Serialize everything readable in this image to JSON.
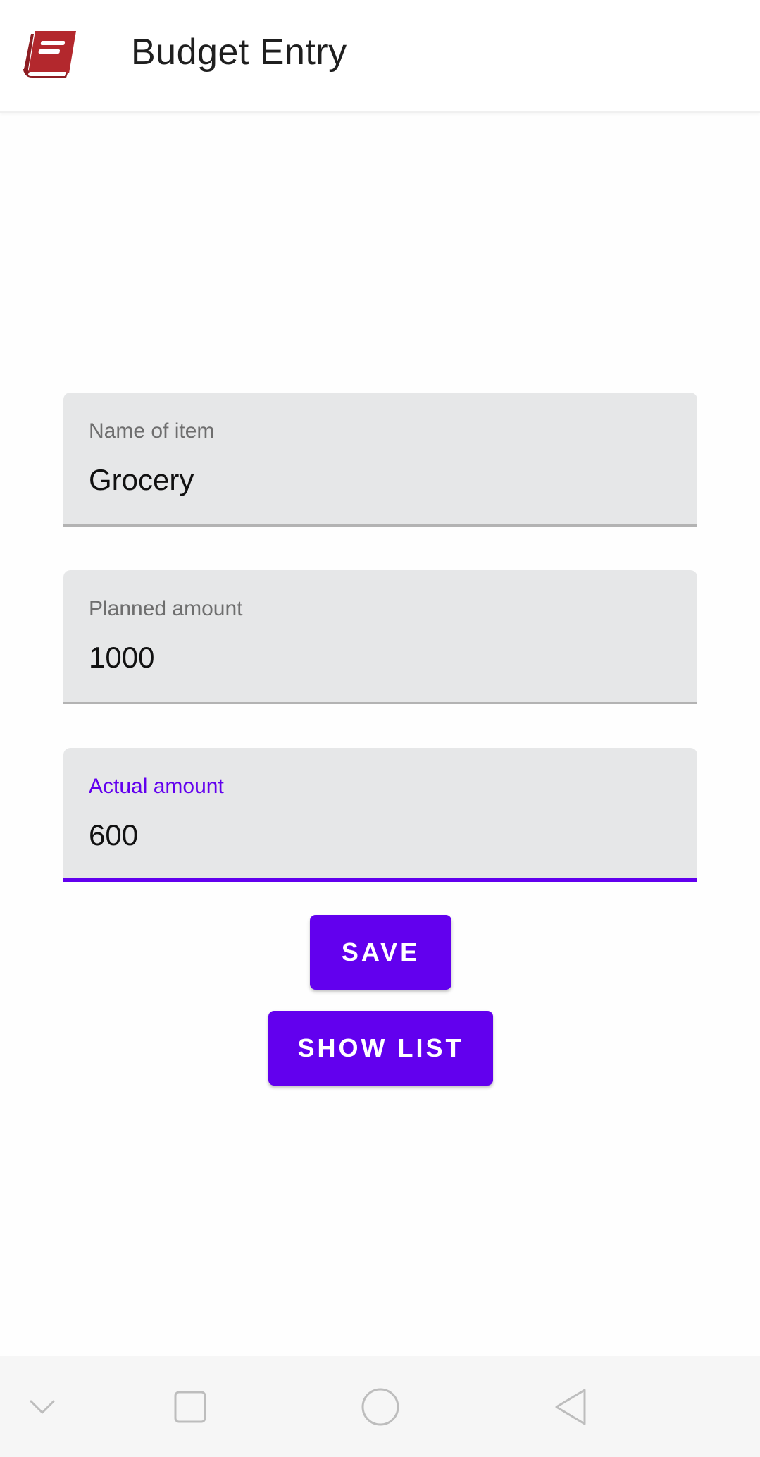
{
  "app_bar": {
    "title": "Budget Entry",
    "logo_icon": "book-icon",
    "logo_color": "#b3282d"
  },
  "form": {
    "name_field": {
      "label": "Name of item",
      "value": "Grocery"
    },
    "planned_field": {
      "label": "Planned amount",
      "value": "1000"
    },
    "actual_field": {
      "label": "Actual amount",
      "value": "600",
      "focused": true
    }
  },
  "buttons": {
    "save_label": "SAVE",
    "show_list_label": "SHOW LIST"
  },
  "colors": {
    "accent": "#6200ee",
    "field_background": "#e6e7e8"
  },
  "nav_bar": {
    "items": [
      "chevron-down-icon",
      "recents-square-icon",
      "home-circle-icon",
      "back-triangle-icon"
    ]
  }
}
